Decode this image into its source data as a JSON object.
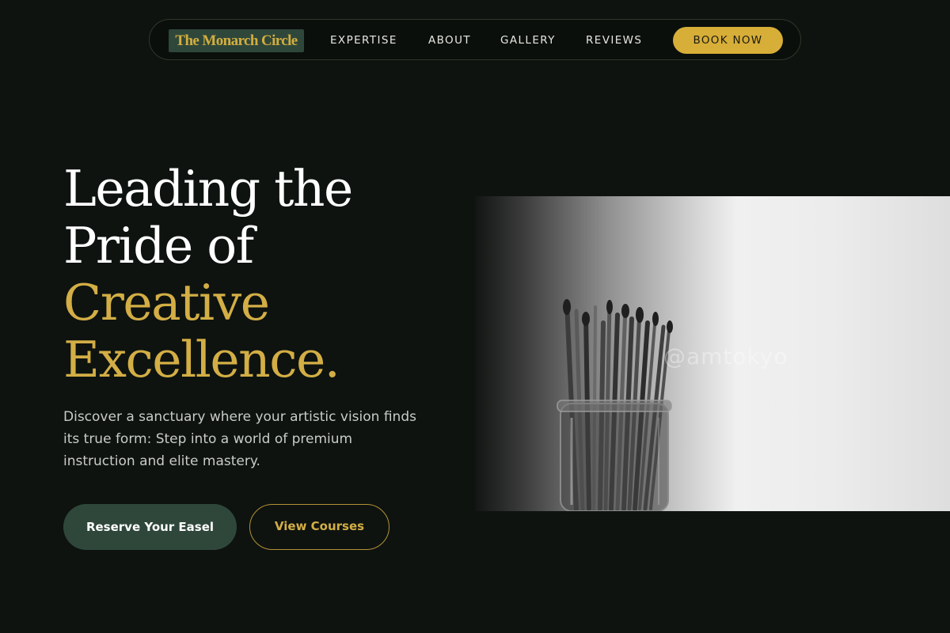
{
  "nav": {
    "brand": "The Monarch Circle",
    "links": [
      "EXPERTISE",
      "ABOUT",
      "GALLERY",
      "REVIEWS"
    ],
    "cta": "BOOK NOW"
  },
  "hero": {
    "headline_lines": [
      "Leading the",
      "Pride of"
    ],
    "headline_accent_lines": [
      "Creative",
      "Excellence."
    ],
    "description": "Discover a sanctuary where your artistic vision finds its true form: Step into a world of premium instruction and elite mastery.",
    "primary_button": "Reserve Your Easel",
    "secondary_button": "View Courses",
    "image": {
      "subject": "paintbrushes-in-glass-jar",
      "watermark": "@amtokyo"
    }
  },
  "colors": {
    "background": "#0e1310",
    "accent_gold": "#d3ae45",
    "accent_green": "#2f473b"
  }
}
